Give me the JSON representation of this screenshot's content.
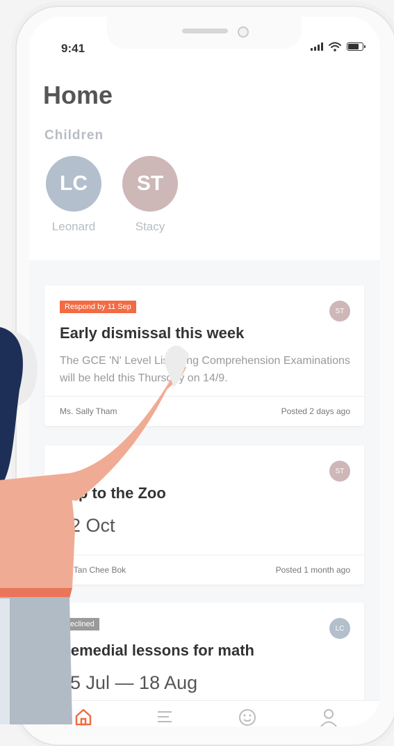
{
  "status": {
    "time": "9:41"
  },
  "page": {
    "title": "Home",
    "section": "Children"
  },
  "children": [
    {
      "initials": "LC",
      "name": "Leonard",
      "color": "#b3bfcc"
    },
    {
      "initials": "ST",
      "name": "Stacy",
      "color": "#cdb7b7"
    }
  ],
  "cards": [
    {
      "badge": "Respond by 11 Sep",
      "badge_color": "#f26b43",
      "avatar": "ST",
      "title": "Early dismissal this week",
      "body": "The GCE 'N' Level Listening Comprehension Examinations will be held this Thursday on 14/9.",
      "author": "Ms. Sally Tham",
      "posted": "Posted 2 days ago"
    },
    {
      "avatar": "ST",
      "title": "Trip to the Zoo",
      "date": "22 Oct",
      "author": "Mr. Tan Chee Bok",
      "posted": "Posted 1 month ago"
    },
    {
      "badge": "Declined",
      "badge_color": "#9a9a9a",
      "avatar": "LC",
      "title": "Remedial lessons for math",
      "date": "15 Jul — 18 Aug"
    }
  ],
  "tabs": [
    {
      "icon": "home-icon",
      "active": true
    },
    {
      "icon": "list-icon"
    },
    {
      "icon": "smiley-icon"
    },
    {
      "icon": "profile-icon"
    }
  ],
  "colors": {
    "accent": "#f26b43",
    "figure_shirt": "#f0ab95",
    "figure_hair": "#1e2f57",
    "figure_pants": "#b1bbc6"
  }
}
